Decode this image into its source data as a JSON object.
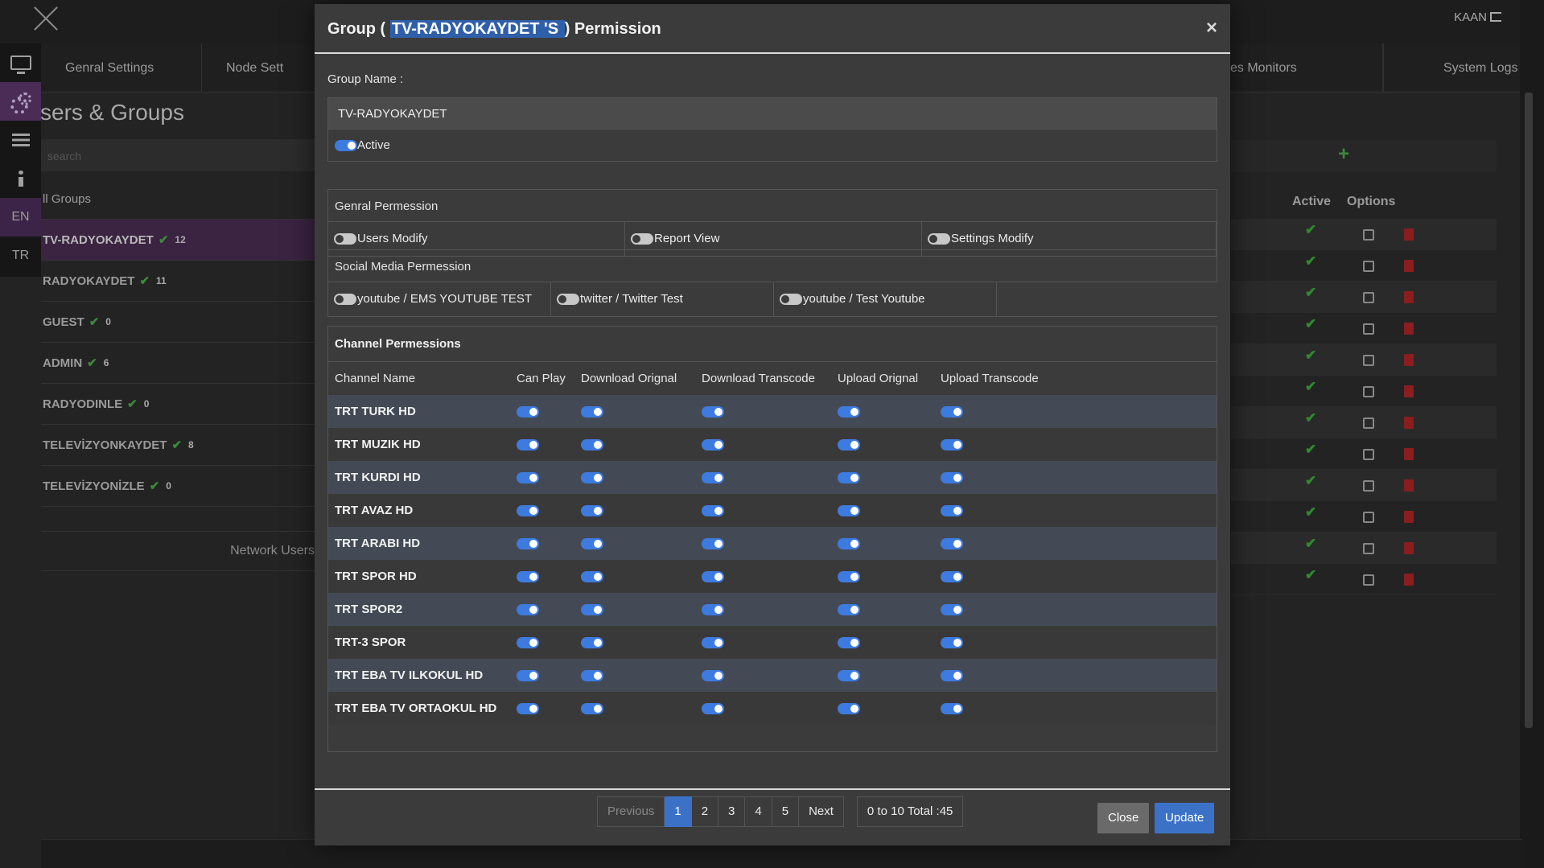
{
  "app": {
    "user": "KAAN",
    "tabs": [
      "Genral Settings",
      "Node Sett",
      "es Monitors",
      "System Logs"
    ],
    "sidenav": {
      "lang_en": "EN",
      "lang_tr": "TR"
    },
    "page_title": "sers & Groups",
    "search_placeholder": "search",
    "groups": [
      {
        "name": "ll Groups",
        "count": "",
        "check": false
      },
      {
        "name": "TV-RADYOKAYDET",
        "count": "12",
        "check": true
      },
      {
        "name": "RADYOKAYDET",
        "count": "11",
        "check": true
      },
      {
        "name": "GUEST",
        "count": "0",
        "check": true
      },
      {
        "name": "ADMIN",
        "count": "6",
        "check": true
      },
      {
        "name": "RADYODINLE",
        "count": "0",
        "check": true
      },
      {
        "name": "TELEVİZYONKAYDET",
        "count": "8",
        "check": true
      },
      {
        "name": "TELEVİZYONİZLE",
        "count": "0",
        "check": true
      }
    ],
    "network_users": "Network Users",
    "users_table": {
      "active_header": "Active",
      "options_header": "Options",
      "add_symbol": "+"
    }
  },
  "modal": {
    "title_prefix": "Group ( ",
    "title_group": "TV-RADYOKAYDET 'S ",
    "title_suffix": ") Permission",
    "close_symbol": "×",
    "group_name_label": "Group Name :",
    "group_name_value": "TV-RADYOKAYDET",
    "active_label": "Active",
    "general": {
      "title": "Genral Permession",
      "items": [
        {
          "label": "Users Modify",
          "on": false
        },
        {
          "label": "Report View",
          "on": false
        },
        {
          "label": "Settings Modify",
          "on": false
        }
      ]
    },
    "social": {
      "title": "Social Media Permession",
      "items": [
        {
          "label": "youtube / EMS YOUTUBE TEST",
          "on": false
        },
        {
          "label": "twitter / Twitter Test",
          "on": false
        },
        {
          "label": "youtube / Test Youtube",
          "on": false
        }
      ]
    },
    "channels": {
      "title": "Channel Permessions",
      "columns": [
        "Channel Name",
        "Can Play",
        "Download Orignal",
        "Download Transcode",
        "Upload Orignal",
        "Upload Transcode"
      ],
      "rows": [
        "TRT TURK HD",
        "TRT MUZIK HD",
        "TRT KURDI HD",
        "TRT AVAZ HD",
        "TRT ARABI HD",
        "TRT SPOR HD",
        "TRT SPOR2",
        "TRT-3 SPOR",
        "TRT EBA TV ILKOKUL HD",
        "TRT EBA TV ORTAOKUL HD"
      ]
    },
    "pagination": {
      "previous": "Previous",
      "pages": [
        "1",
        "2",
        "3",
        "4",
        "5"
      ],
      "current": "1",
      "next": "Next",
      "info": "0 to 10 Total :45"
    },
    "footer": {
      "close": "Close",
      "update": "Update"
    }
  },
  "colors": {
    "accent": "#3b72c8",
    "toggle_on": "#3d7be0",
    "nav_active": "#4a2c56",
    "success": "#2f8a2f",
    "danger": "#8a1e1e"
  }
}
